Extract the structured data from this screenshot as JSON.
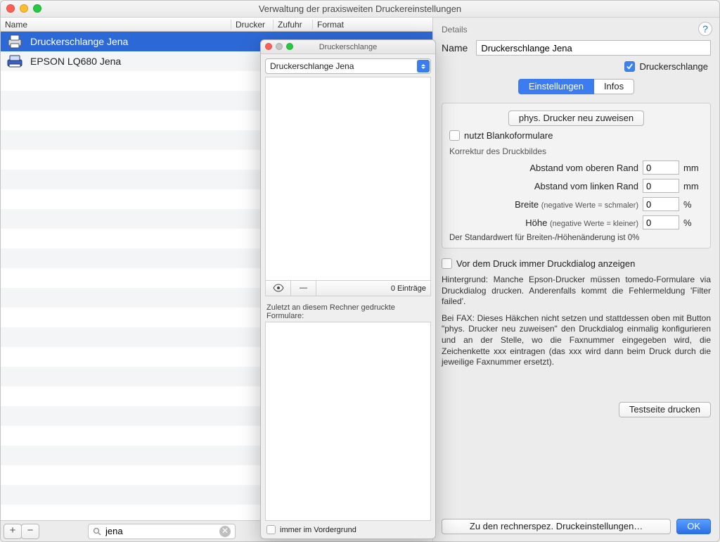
{
  "window": {
    "title": "Verwaltung der praxisweiten Druckereinstellungen"
  },
  "table": {
    "headers": [
      "Name",
      "Drucker",
      "Zufuhr",
      "Format"
    ],
    "rows": [
      {
        "name": "Druckerschlange Jena",
        "selected": true,
        "icon": "printer"
      },
      {
        "name": "EPSON LQ680 Jena",
        "selected": false,
        "icon": "dotmatrix"
      }
    ]
  },
  "list_footer": {
    "add": "+",
    "remove": "−",
    "search_value": "jena"
  },
  "details": {
    "heading": "Details",
    "name_label": "Name",
    "name_value": "Druckerschlange Jena",
    "queue_checkbox_label": "Druckerschlange",
    "queue_checkbox_on": true,
    "tabs": {
      "settings": "Einstellungen",
      "info": "Infos",
      "active": "settings"
    },
    "assign_button": "phys. Drucker neu zuweisen",
    "blank_forms_label": "nutzt Blankoformulare",
    "blank_forms_on": false,
    "correction_title": "Korrektur des Druckbildes",
    "fields": {
      "top": {
        "label": "Abstand vom oberen Rand",
        "value": "0",
        "unit": "mm"
      },
      "left": {
        "label": "Abstand vom linken Rand",
        "value": "0",
        "unit": "mm"
      },
      "width": {
        "label": "Breite",
        "hint": "(negative Werte = schmaler)",
        "value": "0",
        "unit": "%"
      },
      "height": {
        "label": "Höhe",
        "hint": "(negative Werte = kleiner)",
        "value": "0",
        "unit": "%"
      }
    },
    "default_note": "Der Standardwert für Breiten-/Höhenänderung ist 0%",
    "dialog_checkbox_label": "Vor dem Druck immer Druckdialog anzeigen",
    "dialog_checkbox_on": false,
    "help_text1": "Hintergrund: Manche Epson-Drucker müssen tomedo-Formulare via Druckdialog drucken. Anderenfalls kommt die Fehlermeldung 'Filter failed'.",
    "help_text2": "Bei FAX: Dieses Häkchen nicht setzen und stattdessen oben mit Button \"phys. Drucker neu zuweisen\" den Druckdialog einmalig konfigurieren und an der Stelle, wo die Faxnummer eingegeben wird, die Zeichenkette xxx eintragen (das xxx wird dann beim Druck durch die jeweilige Faxnummer ersetzt).",
    "testpage_button": "Testseite drucken",
    "local_settings_button": "Zu den rechnerspez. Druckeinstellungen…",
    "ok_button": "OK"
  },
  "popup": {
    "title": "Druckerschlange",
    "select_value": "Druckerschlange Jena",
    "entries_label": "0 Einträge",
    "recent_label": "Zuletzt an diesem Rechner gedruckte Formulare:",
    "foreground_label": "immer im Vordergrund",
    "foreground_on": false
  },
  "help_tooltip": "?"
}
